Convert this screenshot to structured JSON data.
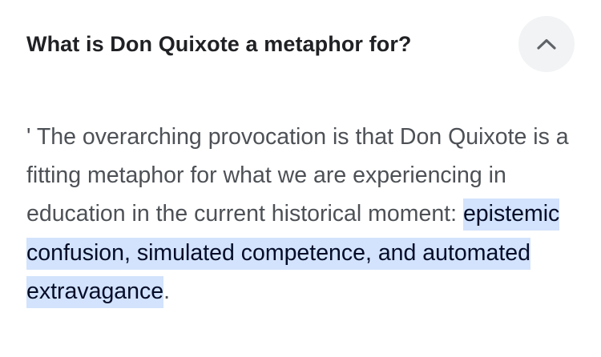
{
  "faq": {
    "question": "What is Don Quixote a metaphor for?",
    "toggle_icon": "chevron-up-icon",
    "answer_plain": "' The overarching provocation is that Don Quixote is a fitting metaphor for what we are experiencing in education in the current historical moment: ",
    "answer_highlight": "epistemic confusion, simulated competence, and automated extravagance",
    "answer_end": "."
  },
  "colors": {
    "highlight_background": "#d3e3fd",
    "highlight_text": "#040c28",
    "body_text": "#4d5156",
    "title_text": "#202124",
    "button_background": "#f1f3f4"
  }
}
